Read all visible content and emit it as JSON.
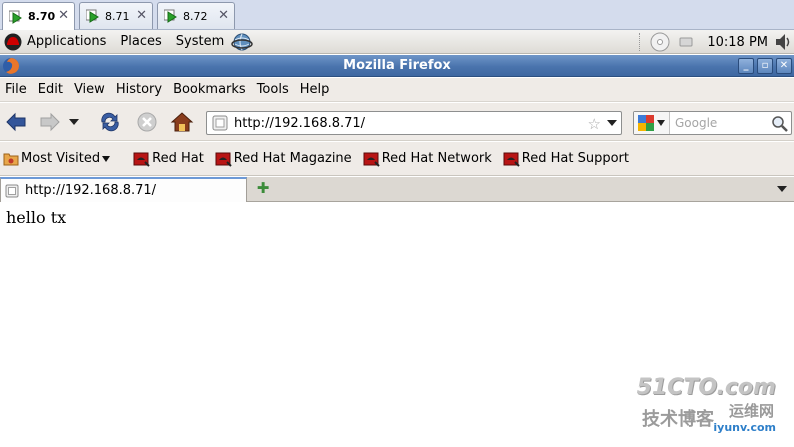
{
  "vnc_tabs": [
    {
      "label": "8.70",
      "active": true
    },
    {
      "label": "8.71",
      "active": false
    },
    {
      "label": "8.72",
      "active": false
    }
  ],
  "panel": {
    "menus": [
      "Applications",
      "Places",
      "System"
    ],
    "clock": "10:18 PM"
  },
  "window": {
    "title": "Mozilla Firefox",
    "controls": [
      "minimize",
      "maximize",
      "close"
    ]
  },
  "menubar": [
    "File",
    "Edit",
    "View",
    "History",
    "Bookmarks",
    "Tools",
    "Help"
  ],
  "navbar": {
    "url": "http://192.168.8.71/",
    "search_placeholder": "Google"
  },
  "bookmarks": {
    "most_visited": "Most Visited",
    "items": [
      "Red Hat",
      "Red Hat Magazine",
      "Red Hat Network",
      "Red Hat Support"
    ]
  },
  "tab": {
    "title": "http://192.168.8.71/"
  },
  "content": {
    "text": "hello tx"
  },
  "watermark": {
    "brand": "51CTO.com",
    "left": "技术博客",
    "right": "运维网",
    "url": "iyunv.com"
  },
  "colors": {
    "title_bar": "#4a74ad",
    "tab_accent": "#6d99d6",
    "redhat_red": "#cc0000",
    "toolbar_bg": "#efebe7"
  }
}
